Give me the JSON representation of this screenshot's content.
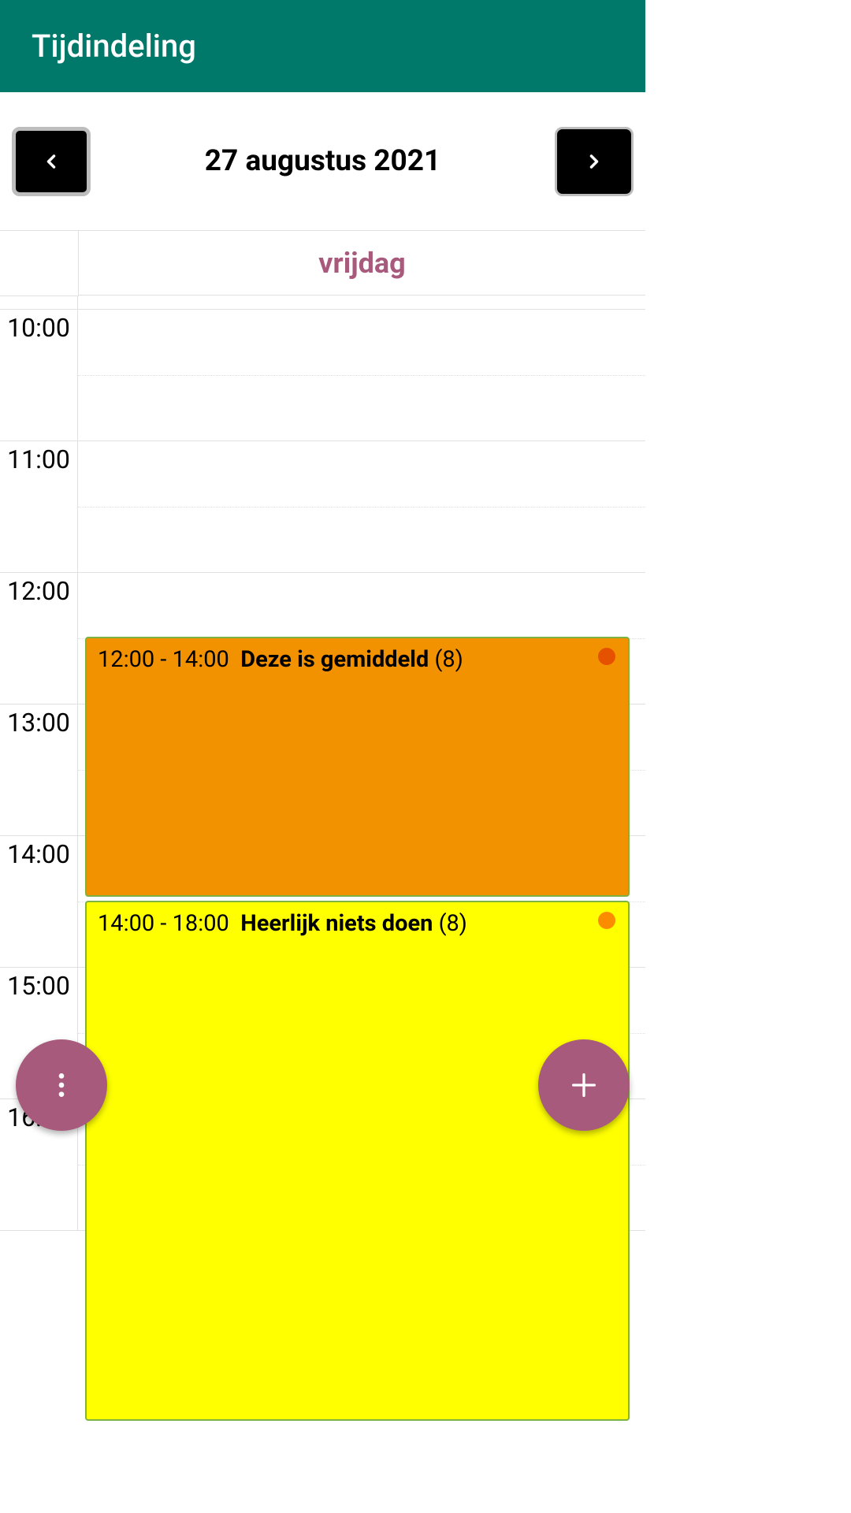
{
  "header": {
    "title": "Tijdindeling"
  },
  "date_nav": {
    "date": "27 augustus 2021"
  },
  "schedule": {
    "day_name": "vrijdag",
    "time_labels": [
      "10:00",
      "11:00",
      "12:00",
      "13:00",
      "14:00",
      "15:00",
      "16:00"
    ],
    "events": [
      {
        "time_range": "12:00 - 14:00",
        "title": "Deze is gemiddeld",
        "count": "(8)",
        "bg_color": "#f39200",
        "dot_color": "#e65100"
      },
      {
        "time_range": "14:00 - 18:00",
        "title": "Heerlijk niets doen",
        "count": "(8)",
        "bg_color": "#ffff00",
        "dot_color": "#fb8c00"
      }
    ]
  }
}
